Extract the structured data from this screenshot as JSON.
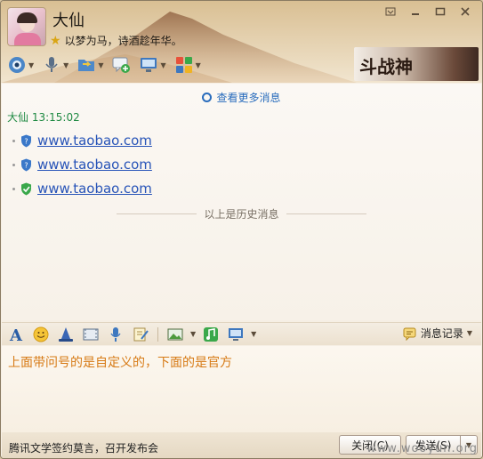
{
  "contact": {
    "nickname": "大仙",
    "signature": "以梦为马，诗酒趁年华。"
  },
  "banner": {
    "text": "斗战神"
  },
  "messages": {
    "view_more": "查看更多消息",
    "sender_line": "大仙  13:15:02",
    "items": [
      {
        "text": "www.taobao.com",
        "shield": "custom"
      },
      {
        "text": "www.taobao.com",
        "shield": "custom"
      },
      {
        "text": "www.taobao.com",
        "shield": "official"
      }
    ],
    "history_divider": "以上是历史消息"
  },
  "input_toolbar": {
    "history_label": "消息记录"
  },
  "input": {
    "text": "上面带问号的是自定义的，下面的是官方"
  },
  "footer": {
    "ad_text": "腾讯文学签约莫言，召开发布会",
    "close_label": "关闭(C)",
    "send_label": "发送(S)"
  },
  "watermark": "www.wooyun.org",
  "colors": {
    "link": "#2854b8",
    "sender": "#1f8a43",
    "input_text": "#d77a15",
    "shield_custom": "#3a78c9",
    "shield_official": "#3aa84a"
  }
}
